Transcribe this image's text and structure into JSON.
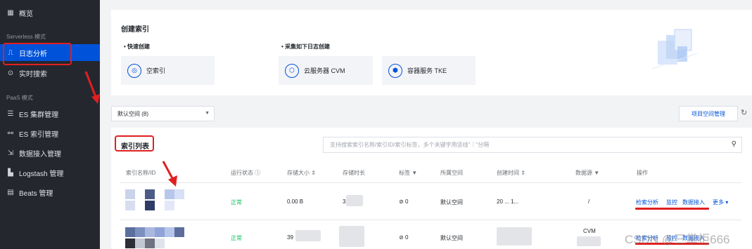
{
  "sidebar": {
    "overview": "概览",
    "serverless_section": "Serverless 模式",
    "log_analysis": "日志分析",
    "realtime_search": "实时搜索",
    "paas_section": "PaaS 模式",
    "es_cluster": "ES 集群管理",
    "es_index": "ES 索引管理",
    "data_ingest": "数据接入管理",
    "logstash": "Logstash 管理",
    "beats": "Beats 管理"
  },
  "create_index": {
    "title": "创建索引",
    "quick_create": "快速创建",
    "empty_index": "空索引",
    "collect_create": "采集如下日志创建",
    "cvm": "云服务器 CVM",
    "tke": "容器服务 TKE"
  },
  "toolbar": {
    "space_select": "默认空间 (8)",
    "project_space_btn": "项目空间管理"
  },
  "index_list": {
    "title": "索引列表",
    "search_placeholder": "支持搜索索引名称/索引ID/索引标签，多个关键字用竖线\"｜\"分隔",
    "columns": {
      "name": "索引名称/ID",
      "status": "运行状态 ⓘ",
      "size": "存储大小 ⇕",
      "duration": "存储时长",
      "tags": "标签 ▼",
      "space": "所属空间",
      "created": "创建时间 ⇕",
      "source": "数据源 ▼",
      "actions": "操作"
    },
    "rows": [
      {
        "status": "正常",
        "size": "0.00 B",
        "duration": "3",
        "tags": "0",
        "space": "默认空间",
        "created": "20 ... 1...",
        "source": "/"
      },
      {
        "status": "正常",
        "size": "39",
        "duration": "",
        "tags": "0",
        "space": "默认空间",
        "created": "",
        "source": "CVM"
      }
    ],
    "actions": {
      "search_analysis": "检索分析",
      "monitor": "监控",
      "data_ingest": "数据接入",
      "more": "更多 ▾"
    }
  },
  "watermark": "CSDN @三掌柜666",
  "colors": {
    "accent": "#0052d9",
    "sidebar_bg": "#25272e",
    "status_ok": "#0abf5b",
    "annotation_red": "#e02020"
  }
}
